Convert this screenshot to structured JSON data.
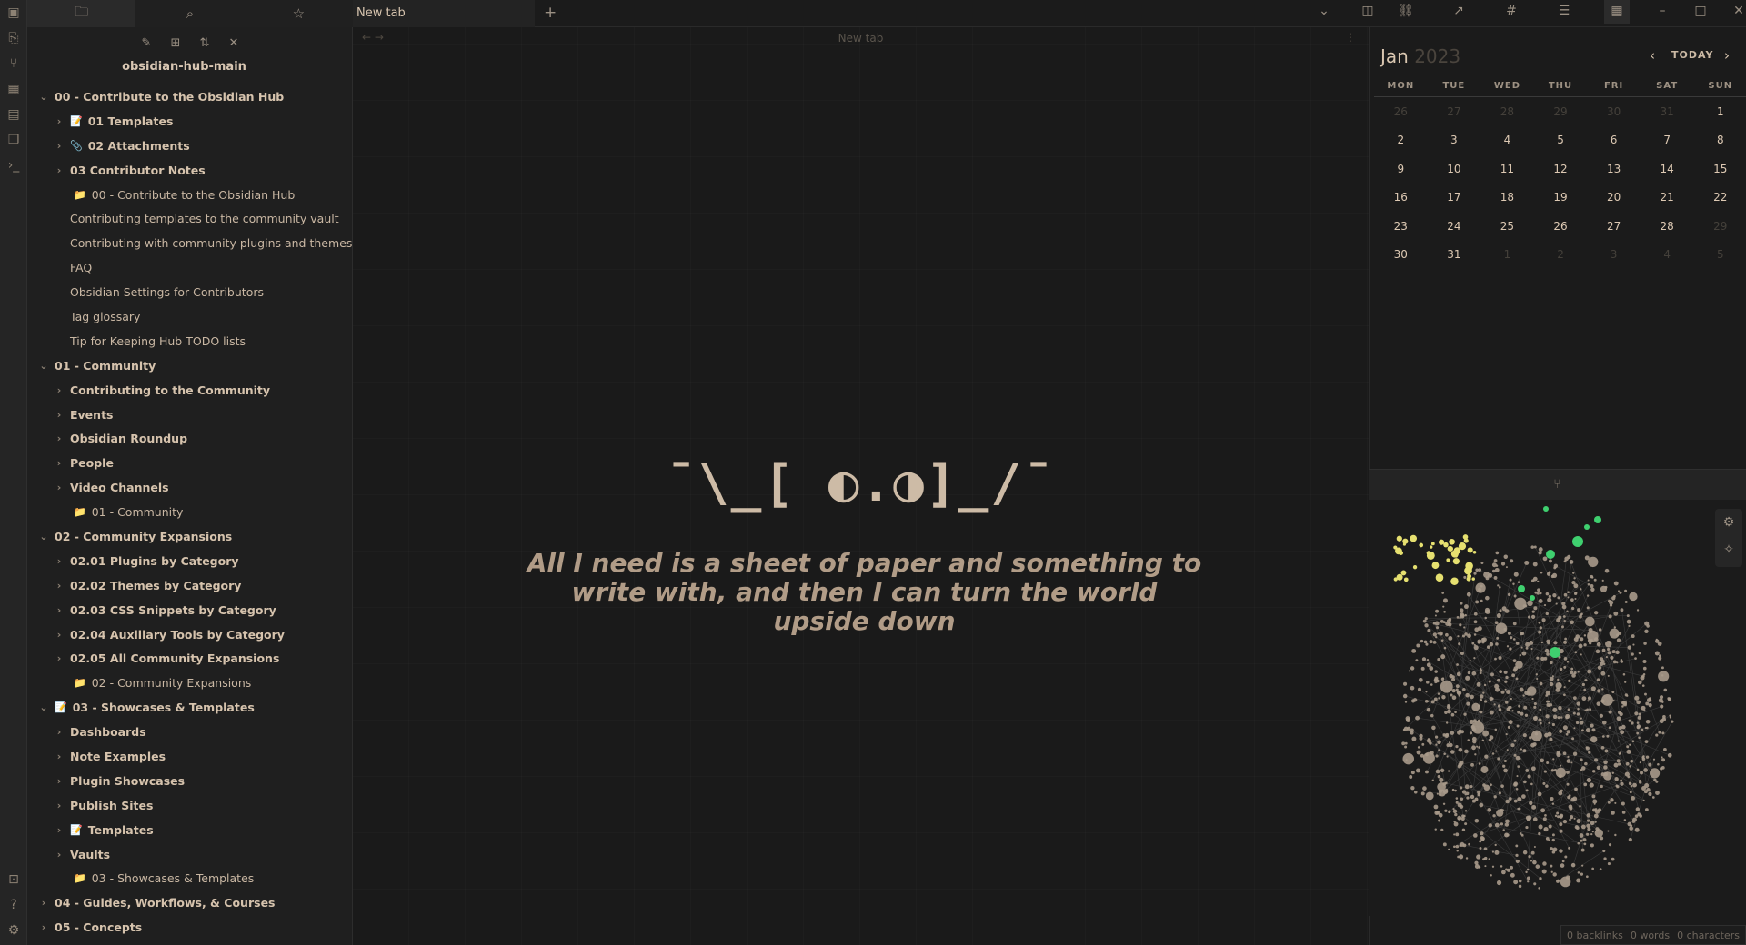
{
  "ribbon": {
    "icons": [
      "sidebar-toggle-icon",
      "open-quick-switcher-icon",
      "graph-view-icon",
      "canvas-icon",
      "daily-note-icon",
      "templates-icon",
      "command-palette-icon"
    ],
    "bottom_icons": [
      "vault-switcher-icon",
      "help-icon",
      "settings-icon"
    ]
  },
  "sidebar": {
    "tabs": [
      "files-icon",
      "search-icon",
      "bookmarks-icon"
    ],
    "actions": [
      "new-note-icon",
      "new-folder-icon",
      "sort-icon",
      "collapse-all-icon"
    ],
    "vault_name": "obsidian-hub-main",
    "items": [
      {
        "label": "00 - Contribute to the Obsidian Hub",
        "type": "folder",
        "depth": 0,
        "open": true
      },
      {
        "label": "01 Templates",
        "type": "folder",
        "depth": 1,
        "emoji": "📝"
      },
      {
        "label": "02 Attachments",
        "type": "folder",
        "depth": 1,
        "emoji": "📎"
      },
      {
        "label": "03 Contributor Notes",
        "type": "folder",
        "depth": 1
      },
      {
        "label": "00 - Contribute to the Obsidian Hub",
        "type": "note",
        "depth": 1,
        "emoji": "📁"
      },
      {
        "label": "Contributing templates to the community vault",
        "type": "note",
        "depth": 1
      },
      {
        "label": "Contributing with community plugins and themes",
        "type": "note",
        "depth": 1
      },
      {
        "label": "FAQ",
        "type": "note",
        "depth": 1
      },
      {
        "label": "Obsidian Settings for Contributors",
        "type": "note",
        "depth": 1
      },
      {
        "label": "Tag glossary",
        "type": "note",
        "depth": 1
      },
      {
        "label": "Tip for Keeping Hub TODO lists",
        "type": "note",
        "depth": 1
      },
      {
        "label": "01 - Community",
        "type": "folder",
        "depth": 0,
        "open": true
      },
      {
        "label": "Contributing to the Community",
        "type": "folder",
        "depth": 1
      },
      {
        "label": "Events",
        "type": "folder",
        "depth": 1
      },
      {
        "label": "Obsidian Roundup",
        "type": "folder",
        "depth": 1
      },
      {
        "label": "People",
        "type": "folder",
        "depth": 1
      },
      {
        "label": "Video Channels",
        "type": "folder",
        "depth": 1
      },
      {
        "label": "01 - Community",
        "type": "note",
        "depth": 1,
        "emoji": "📁"
      },
      {
        "label": "02 - Community Expansions",
        "type": "folder",
        "depth": 0,
        "open": true
      },
      {
        "label": "02.01 Plugins by Category",
        "type": "folder",
        "depth": 1
      },
      {
        "label": "02.02 Themes by Category",
        "type": "folder",
        "depth": 1
      },
      {
        "label": "02.03 CSS Snippets by Category",
        "type": "folder",
        "depth": 1
      },
      {
        "label": "02.04 Auxiliary Tools by Category",
        "type": "folder",
        "depth": 1
      },
      {
        "label": "02.05 All Community Expansions",
        "type": "folder",
        "depth": 1
      },
      {
        "label": "02 - Community Expansions",
        "type": "note",
        "depth": 1,
        "emoji": "📁"
      },
      {
        "label": "03 - Showcases & Templates",
        "type": "folder",
        "depth": 0,
        "open": true,
        "emoji": "📝"
      },
      {
        "label": "Dashboards",
        "type": "folder",
        "depth": 1
      },
      {
        "label": "Note Examples",
        "type": "folder",
        "depth": 1
      },
      {
        "label": "Plugin Showcases",
        "type": "folder",
        "depth": 1
      },
      {
        "label": "Publish Sites",
        "type": "folder",
        "depth": 1
      },
      {
        "label": "Templates",
        "type": "folder",
        "depth": 1,
        "emoji": "📝"
      },
      {
        "label": "Vaults",
        "type": "folder",
        "depth": 1
      },
      {
        "label": "03 - Showcases & Templates",
        "type": "note",
        "depth": 1,
        "emoji": "📁"
      },
      {
        "label": "04 - Guides, Workflows, & Courses",
        "type": "folder",
        "depth": 0,
        "open": false
      },
      {
        "label": "05 - Concepts",
        "type": "folder",
        "depth": 0,
        "open": false
      }
    ]
  },
  "tabbar": {
    "tab_title": "New tab",
    "new_tab_icon": "plus-icon",
    "right_icons": [
      "tab-list-chevron-icon",
      "split-view-icon",
      "backlinks-icon",
      "outgoing-links-icon",
      "tags-icon",
      "outline-icon",
      "calendar-icon",
      "minimize-icon",
      "maximize-icon",
      "close-icon"
    ]
  },
  "view": {
    "header_title": "New tab",
    "shrug": "¯\\_[ ◐.◑]_/¯",
    "quote": "All I need is a sheet of paper and something to write with, and then I can turn the world upside down"
  },
  "calendar": {
    "month": "Jan",
    "year": "2023",
    "today_label": "TODAY",
    "days_of_week": [
      "MON",
      "TUE",
      "WED",
      "THU",
      "FRI",
      "SAT",
      "SUN"
    ],
    "weeks": [
      [
        {
          "d": "26",
          "dim": true
        },
        {
          "d": "27",
          "dim": true
        },
        {
          "d": "28",
          "dim": true
        },
        {
          "d": "29",
          "dim": true
        },
        {
          "d": "30",
          "dim": true
        },
        {
          "d": "31",
          "dim": true
        },
        {
          "d": "1"
        }
      ],
      [
        {
          "d": "2"
        },
        {
          "d": "3"
        },
        {
          "d": "4"
        },
        {
          "d": "5"
        },
        {
          "d": "6"
        },
        {
          "d": "7"
        },
        {
          "d": "8"
        }
      ],
      [
        {
          "d": "9"
        },
        {
          "d": "10"
        },
        {
          "d": "11"
        },
        {
          "d": "12"
        },
        {
          "d": "13"
        },
        {
          "d": "14"
        },
        {
          "d": "15"
        }
      ],
      [
        {
          "d": "16"
        },
        {
          "d": "17"
        },
        {
          "d": "18"
        },
        {
          "d": "19"
        },
        {
          "d": "20"
        },
        {
          "d": "21"
        },
        {
          "d": "22"
        }
      ],
      [
        {
          "d": "23"
        },
        {
          "d": "24"
        },
        {
          "d": "25"
        },
        {
          "d": "26"
        },
        {
          "d": "27"
        },
        {
          "d": "28"
        },
        {
          "d": "29",
          "dim": true
        }
      ],
      [
        {
          "d": "30"
        },
        {
          "d": "31"
        },
        {
          "d": "1",
          "dim": true
        },
        {
          "d": "2",
          "dim": true
        },
        {
          "d": "3",
          "dim": true
        },
        {
          "d": "4",
          "dim": true
        },
        {
          "d": "5",
          "dim": true
        }
      ]
    ]
  },
  "graph": {
    "header_icon": "graph-view-icon",
    "tools": [
      "graph-settings-icon",
      "animate-icon"
    ],
    "colors": {
      "node": "#a89a8b",
      "green": "#3fd06f",
      "yellow": "#e6e070",
      "link": "#3a3a3a"
    }
  },
  "status": {
    "backlinks": "0 backlinks",
    "words": "0 words",
    "characters": "0 characters"
  }
}
